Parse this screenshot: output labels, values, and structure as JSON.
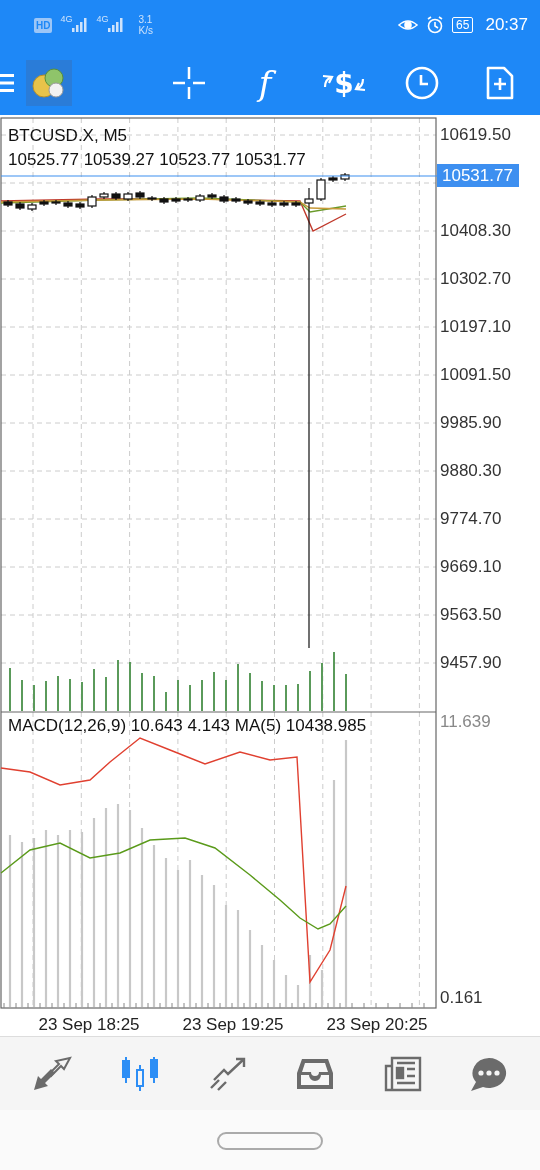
{
  "status_bar": {
    "network": [
      "4G",
      "4G"
    ],
    "hd": "HD",
    "speed": [
      "3.1",
      "K/s"
    ],
    "battery": "65",
    "time": "20:37"
  },
  "toolbar": [
    {
      "kind": "crosshair"
    },
    {
      "kind": "function",
      "glyph": "f"
    },
    {
      "kind": "exchange",
      "glyph": "$"
    },
    {
      "kind": "clock"
    },
    {
      "kind": "new-doc"
    }
  ],
  "chart": {
    "symbol": "BTCUSD.X, M5",
    "ohlc": "10525.77 10539.27 10523.77 10531.77",
    "price_axis": [
      "10619.50",
      "10408.30",
      "10302.70",
      "10197.10",
      "10091.50",
      "9985.90",
      "9880.30",
      "9774.70",
      "9669.10",
      "9563.50",
      "9457.90"
    ],
    "current_price": "10531.77",
    "indicator": "MACD(12,26,9) 10.643 4.143 MA(5) 10438.985",
    "indicator_axis": [
      "11.639",
      "0.161"
    ],
    "time_axis": [
      "23 Sep 18:25",
      "23 Sep 19:25",
      "23 Sep 20:25"
    ]
  },
  "bottom_nav": [
    {
      "kind": "quotes",
      "selected": false
    },
    {
      "kind": "chart",
      "selected": true
    },
    {
      "kind": "trade",
      "selected": false
    },
    {
      "kind": "history",
      "selected": false
    },
    {
      "kind": "news",
      "selected": false
    },
    {
      "kind": "chat",
      "selected": false
    }
  ]
}
